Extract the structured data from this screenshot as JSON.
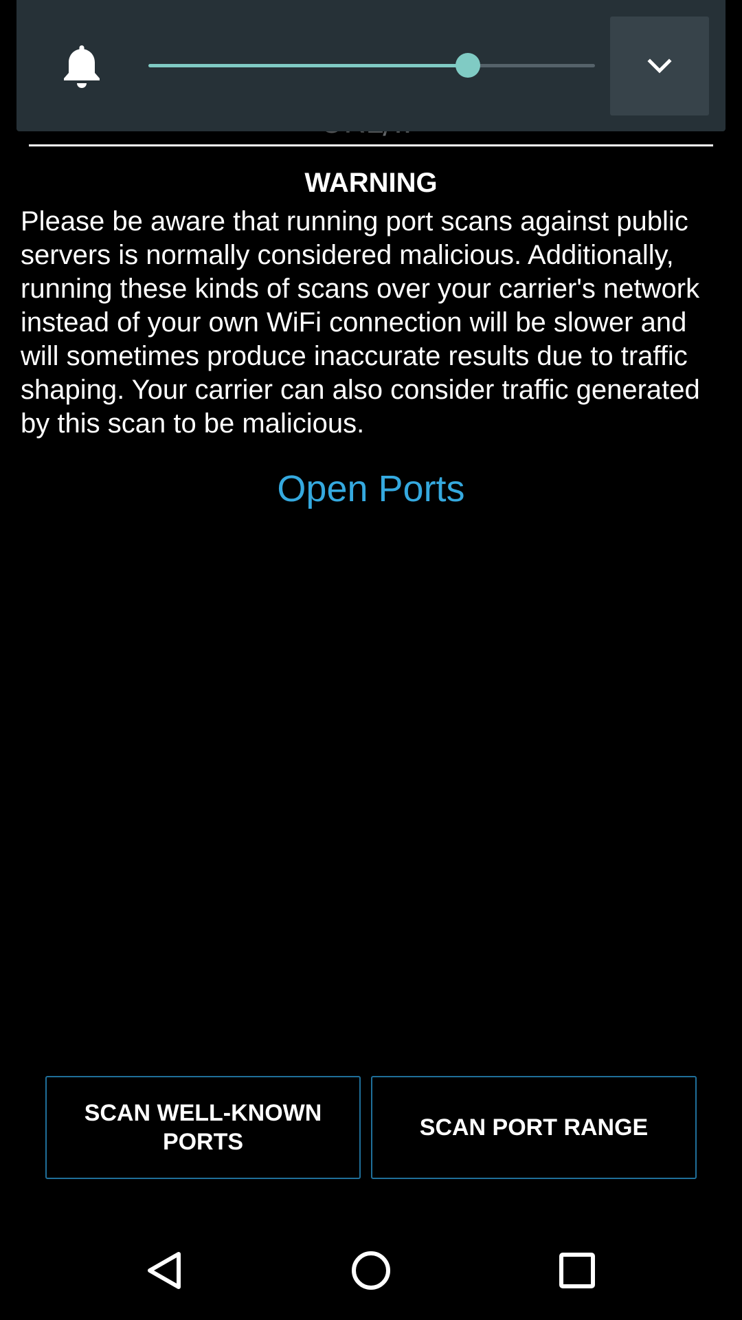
{
  "url_field": {
    "hint_partial": "URL/IP"
  },
  "volume_panel": {
    "icon": "bell-icon",
    "slider_level_fraction": 0.715,
    "expand_icon": "chevron-down-icon",
    "accent_color": "#80cbc4"
  },
  "warning": {
    "title": "WARNING",
    "body": "Please be aware that running port scans against public servers is normally considered malicious. Additionally, running these kinds of scans over your carrier's network instead of your own WiFi connection will be slower and will sometimes produce inaccurate results due to traffic shaping. Your carrier can also consider traffic generated by this scan to be malicious."
  },
  "open_ports": {
    "heading": "Open Ports",
    "heading_color": "#35a9df",
    "items": []
  },
  "actions": {
    "scan_well_known": "SCAN WELL-KNOWN PORTS",
    "scan_port_range": "SCAN PORT RANGE"
  },
  "nav_bar": {
    "back_icon": "back-triangle-icon",
    "home_icon": "home-circle-icon",
    "recents_icon": "recents-square-icon"
  }
}
